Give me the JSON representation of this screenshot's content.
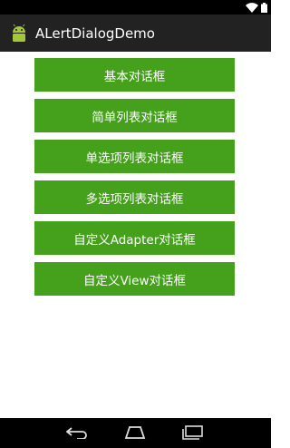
{
  "app": {
    "title": "ALertDialogDemo"
  },
  "buttons": [
    {
      "label": "基本对话框"
    },
    {
      "label": "简单列表对话框"
    },
    {
      "label": "单选项列表对话框"
    },
    {
      "label": "多选项列表对话框"
    },
    {
      "label": "自定义Adapter对话框"
    },
    {
      "label": "自定义View对话框"
    }
  ],
  "icons": {
    "status": [
      "wifi-icon",
      "battery-icon"
    ],
    "app": "android-icon",
    "nav": [
      "back-icon",
      "home-icon",
      "recents-icon"
    ]
  },
  "colors": {
    "button_bg": "#45a01c",
    "actionbar_bg": "#222222",
    "statusbar_bg": "#000000",
    "navbar_bg": "#000000"
  }
}
